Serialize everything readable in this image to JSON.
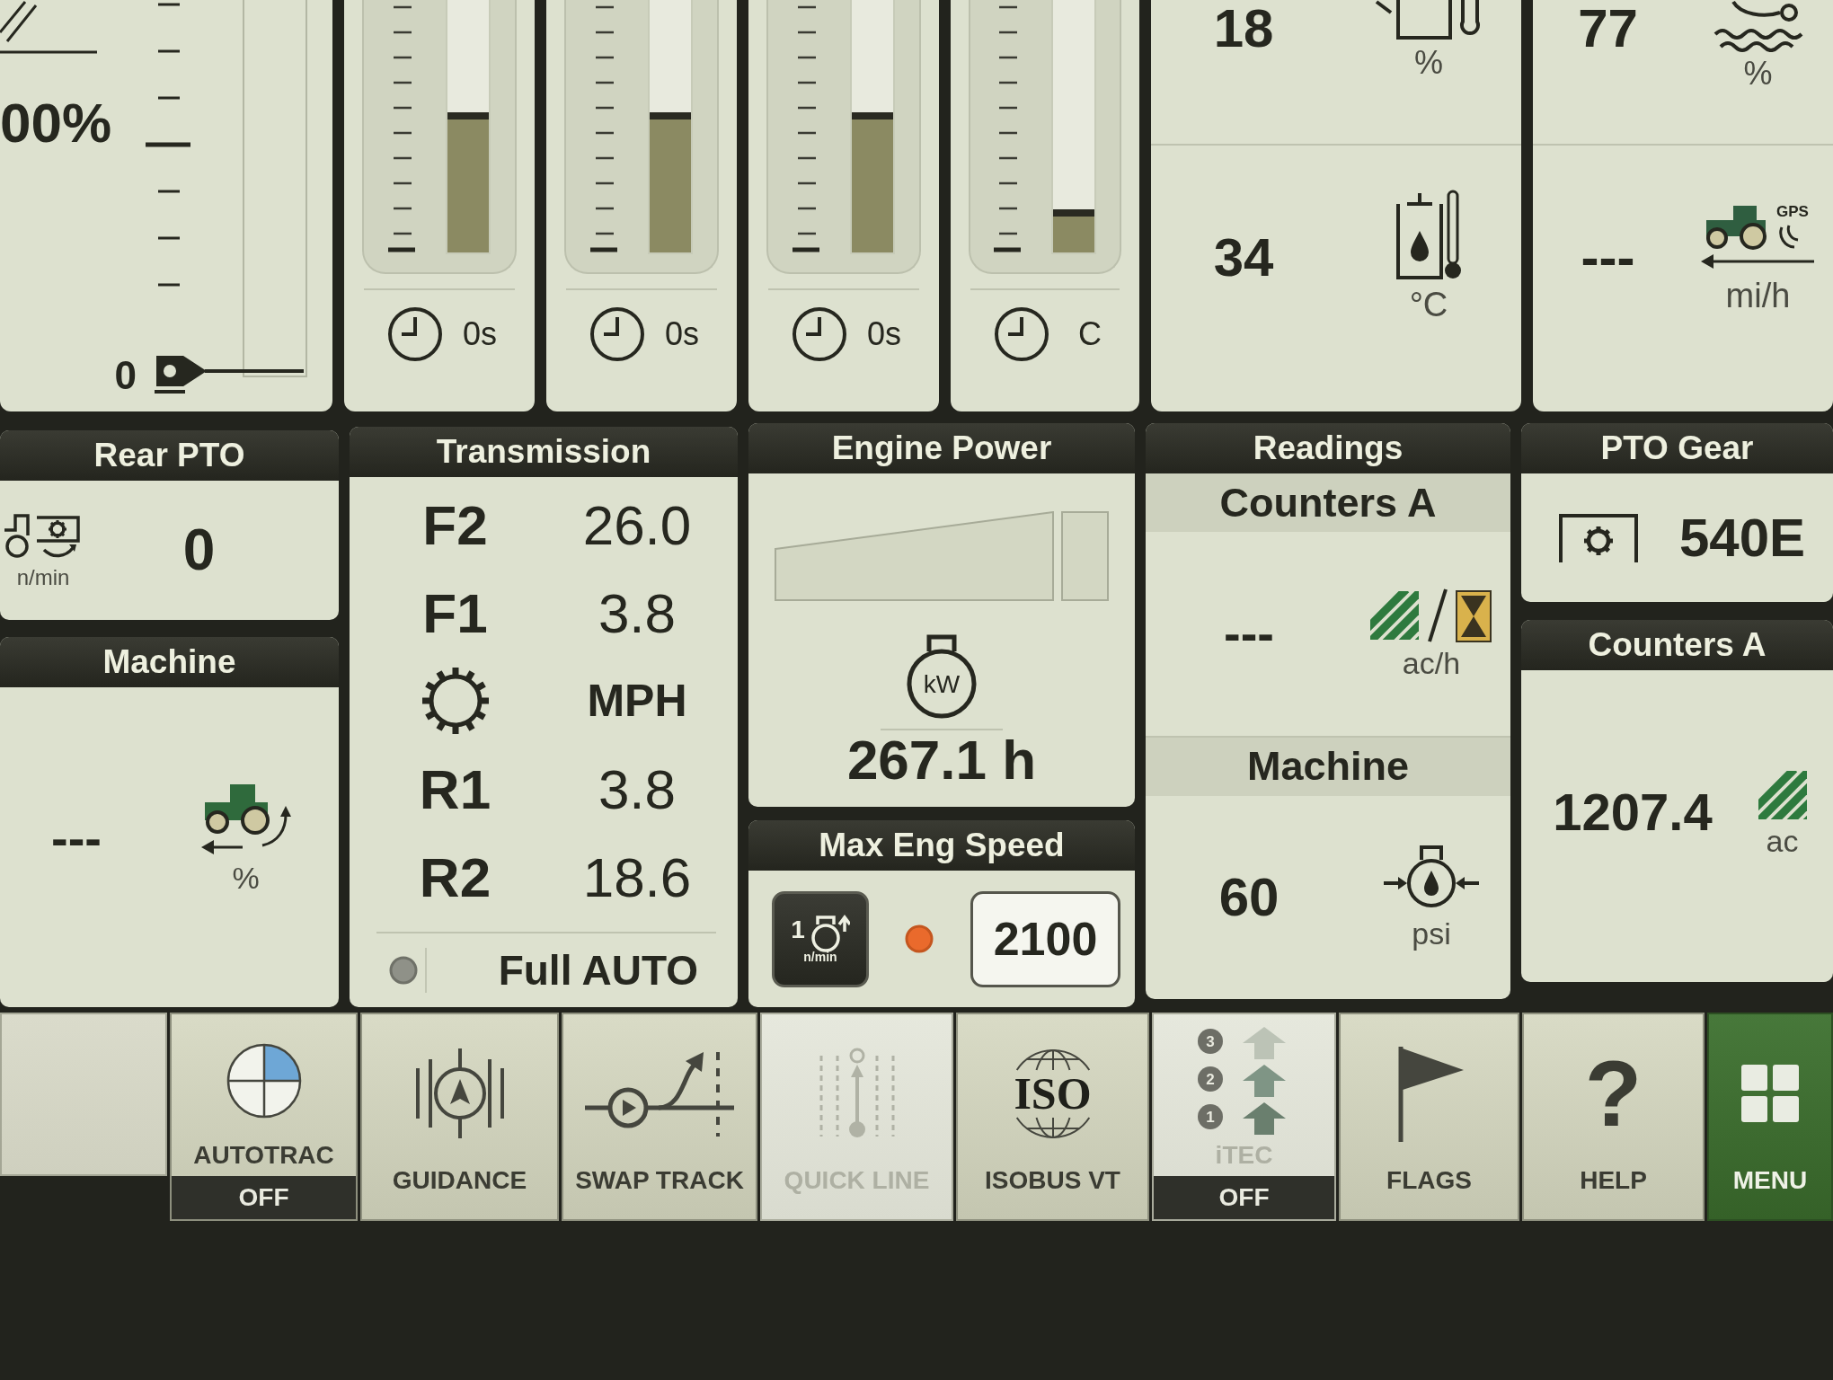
{
  "gauge": {
    "value": "00%",
    "zero_label": "0",
    "level": 0
  },
  "bar_gauges": [
    {
      "level": 0.55,
      "timer": "0s"
    },
    {
      "level": 0.55,
      "timer": "0s"
    },
    {
      "level": 0.55,
      "timer": "0s"
    },
    {
      "level": 0.17,
      "timer": "C"
    }
  ],
  "stat_panels": [
    {
      "cells": [
        {
          "kind": "tank",
          "value": "18",
          "unit": "%"
        },
        {
          "kind": "oil-temp",
          "value": "34",
          "unit": "°C"
        }
      ]
    },
    {
      "cells": [
        {
          "kind": "water",
          "value": "77",
          "unit": "%"
        },
        {
          "kind": "gps-speed",
          "value": "---",
          "unit": "mi/h",
          "icon_text": "GPS"
        }
      ]
    }
  ],
  "rear_pto": {
    "title": "Rear PTO",
    "unit": "n/min",
    "value": "0"
  },
  "machine": {
    "title": "Machine",
    "value": "---",
    "unit": "%"
  },
  "transmission": {
    "title": "Transmission",
    "rows": [
      {
        "kind": "gear",
        "label": "F2",
        "value": "26.0"
      },
      {
        "kind": "gear",
        "label": "F1",
        "value": "3.8"
      },
      {
        "kind": "unit",
        "value": "MPH"
      },
      {
        "kind": "gear",
        "label": "R1",
        "value": "3.8"
      },
      {
        "kind": "gear",
        "label": "R2",
        "value": "18.6"
      }
    ],
    "mode": {
      "label": "Full AUTO",
      "active": false
    }
  },
  "engine_power": {
    "title": "Engine Power",
    "icon_text": "kW",
    "reading": "267.1 h"
  },
  "max_eng_speed": {
    "title": "Max Eng Speed",
    "button": {
      "number": "1",
      "unit": "n/min"
    },
    "indicator_on": true,
    "value": "2100"
  },
  "readings": {
    "title": "Readings",
    "sections": [
      {
        "title": "Counters A",
        "kind": "area-rate",
        "value": "---",
        "unit": "ac/h"
      },
      {
        "title": "Machine",
        "kind": "pressure",
        "value": "60",
        "unit": "psi"
      }
    ]
  },
  "pto_gear": {
    "title": "PTO Gear",
    "value": "540E"
  },
  "counters": {
    "title": "Counters A",
    "value": "1207.4",
    "unit": "ac"
  },
  "softkeys": [
    {
      "kind": "blank",
      "disabled": false
    },
    {
      "kind": "autotrac",
      "label": "AUTOTRAC",
      "status": "OFF",
      "disabled": false
    },
    {
      "kind": "guidance",
      "label": "GUIDANCE",
      "disabled": false
    },
    {
      "kind": "swap-track",
      "label": "SWAP TRACK",
      "disabled": false
    },
    {
      "kind": "quick-line",
      "label": "QUICK LINE",
      "disabled": true
    },
    {
      "kind": "isobus",
      "label": "ISOBUS VT",
      "icon_text": "ISO",
      "disabled": false
    },
    {
      "kind": "itec",
      "label": "iTEC",
      "status": "OFF",
      "steps": [
        "3",
        "2",
        "1"
      ],
      "disabled": true
    },
    {
      "kind": "flags",
      "label": "FLAGS",
      "disabled": false
    },
    {
      "kind": "help",
      "label": "HELP",
      "icon_text": "?",
      "disabled": false
    },
    {
      "kind": "menu",
      "label": "MENU",
      "disabled": false
    }
  ]
}
